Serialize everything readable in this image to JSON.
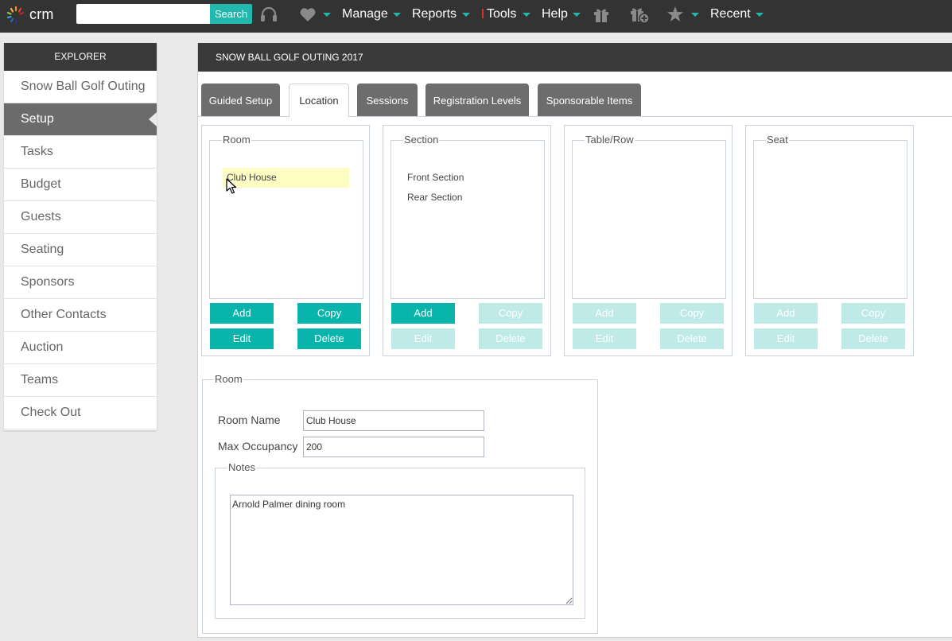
{
  "topbar": {
    "logo_text": "crm",
    "search_placeholder": "",
    "search_button": "Search",
    "nav": [
      {
        "label": "Manage",
        "icon": "caret-down-icon"
      },
      {
        "label": "Reports",
        "icon": "caret-down-icon"
      },
      {
        "label": "Tools",
        "icon": "caret-down-icon"
      },
      {
        "label": "Help",
        "icon": "caret-down-icon"
      },
      {
        "label": "Recent",
        "icon": "caret-down-icon"
      }
    ],
    "icons": [
      "headset-icon",
      "heart-icon",
      "gift-icon",
      "gift-add-icon",
      "star-icon"
    ]
  },
  "explorer": {
    "title": "EXPLORER",
    "items": [
      {
        "label": "Snow Ball Golf Outing",
        "active": false
      },
      {
        "label": "Setup",
        "active": true
      },
      {
        "label": "Tasks",
        "active": false
      },
      {
        "label": "Budget",
        "active": false
      },
      {
        "label": "Guests",
        "active": false
      },
      {
        "label": "Seating",
        "active": false
      },
      {
        "label": "Sponsors",
        "active": false
      },
      {
        "label": "Other Contacts",
        "active": false
      },
      {
        "label": "Auction",
        "active": false
      },
      {
        "label": "Teams",
        "active": false
      },
      {
        "label": "Check Out",
        "active": false
      }
    ]
  },
  "main": {
    "title": "SNOW BALL GOLF OUTING 2017",
    "tabs": [
      {
        "label": "Guided Setup",
        "active": false
      },
      {
        "label": "Location",
        "active": true
      },
      {
        "label": "Sessions",
        "active": false
      },
      {
        "label": "Registration Levels",
        "active": false
      },
      {
        "label": "Sponsorable Items",
        "active": false
      }
    ],
    "panels": [
      {
        "legend": "Room",
        "items": [
          "Club House"
        ],
        "selected": "Club House",
        "buttons": {
          "add": "Add",
          "copy": "Copy",
          "edit": "Edit",
          "delete": "Delete"
        },
        "enabled": {
          "add": true,
          "copy": true,
          "edit": true,
          "delete": true
        }
      },
      {
        "legend": "Section",
        "items": [
          "Front Section",
          "Rear Section"
        ],
        "buttons": {
          "add": "Add",
          "copy": "Copy",
          "edit": "Edit",
          "delete": "Delete"
        },
        "enabled": {
          "add": true,
          "copy": false,
          "edit": false,
          "delete": false
        }
      },
      {
        "legend": "Table/Row",
        "items": [],
        "buttons": {
          "add": "Add",
          "copy": "Copy",
          "edit": "Edit",
          "delete": "Delete"
        },
        "enabled": {
          "add": false,
          "copy": false,
          "edit": false,
          "delete": false
        }
      },
      {
        "legend": "Seat",
        "items": [],
        "buttons": {
          "add": "Add",
          "copy": "Copy",
          "edit": "Edit",
          "delete": "Delete"
        },
        "enabled": {
          "add": false,
          "copy": false,
          "edit": false,
          "delete": false
        }
      }
    ],
    "room_form": {
      "legend": "Room",
      "room_name_label": "Room Name",
      "room_name_value": "Club House",
      "max_occupancy_label": "Max Occupancy",
      "max_occupancy_value": "200",
      "notes_legend": "Notes",
      "notes_value": "Arnold Palmer dining room"
    }
  },
  "colors": {
    "accent": "#09b4aa",
    "accent_disabled": "#bfeae8",
    "topbar": "#333333",
    "header": "#3a3a3a",
    "selected_row": "#fdfcc3"
  }
}
